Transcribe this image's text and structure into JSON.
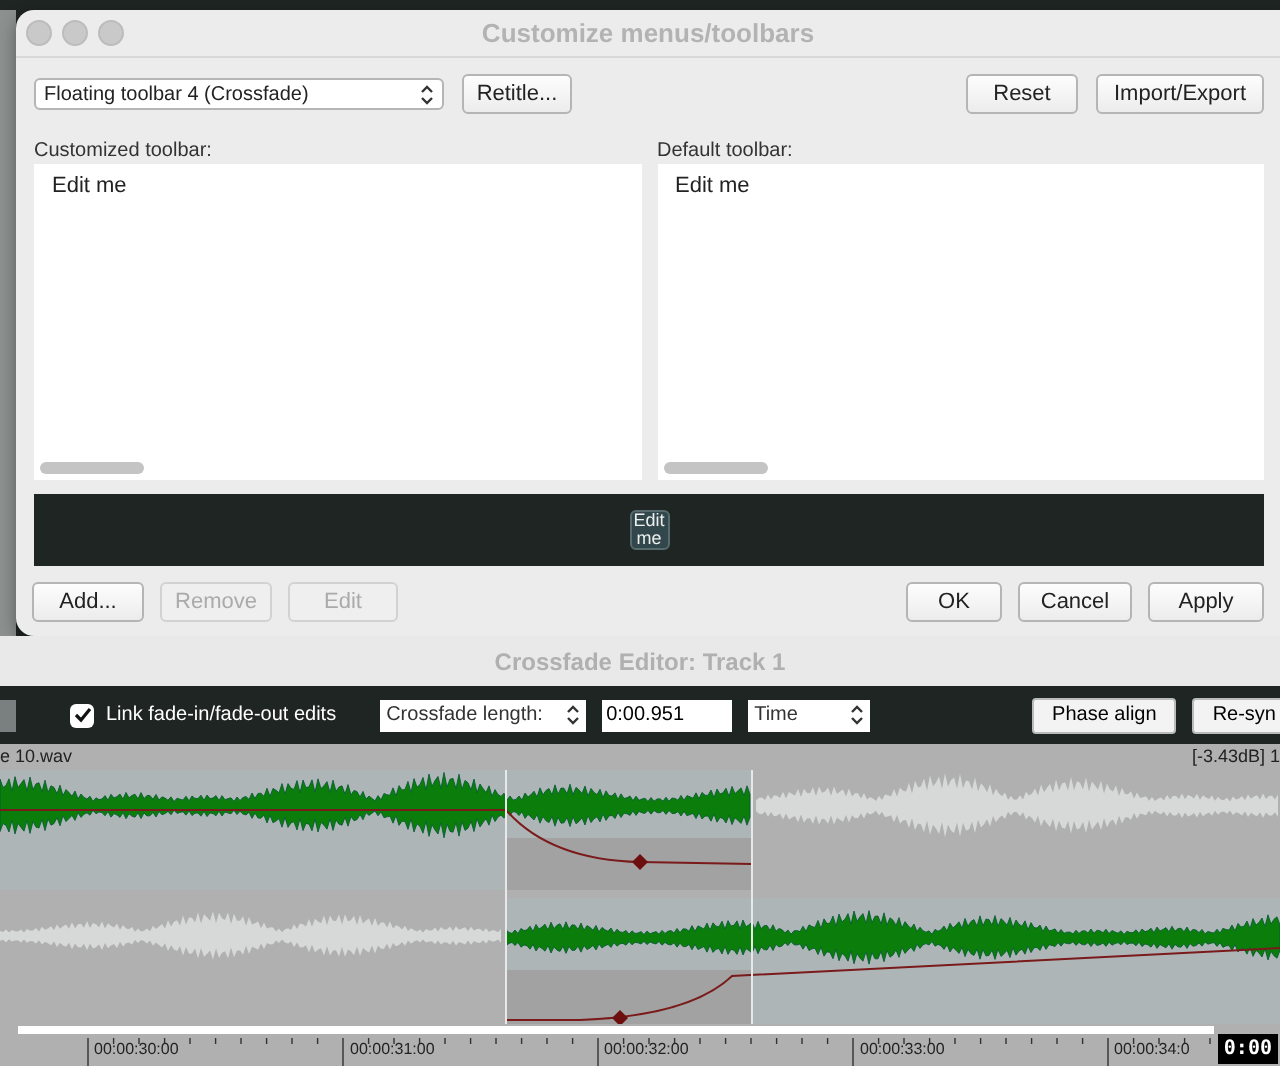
{
  "dialog": {
    "title": "Customize menus/toolbars",
    "toolbar_select": "Floating toolbar 4 (Crossfade)",
    "top_left_buttons": [
      {
        "label": "Retitle..."
      }
    ],
    "top_right_buttons": [
      {
        "label": "Reset"
      },
      {
        "label": "Import/Export"
      }
    ],
    "panels": [
      {
        "label": "Customized toolbar:",
        "items": [
          "Edit me"
        ]
      },
      {
        "label": "Default toolbar:",
        "items": [
          "Edit me"
        ]
      }
    ],
    "preview_button": "Edit me",
    "bottom_left_buttons": [
      {
        "label": "Add...",
        "disabled": false
      },
      {
        "label": "Remove",
        "disabled": true
      },
      {
        "label": "Edit",
        "disabled": true
      }
    ],
    "bottom_right_buttons": [
      {
        "label": "OK",
        "disabled": false
      },
      {
        "label": "Cancel",
        "disabled": false
      },
      {
        "label": "Apply",
        "disabled": false
      }
    ]
  },
  "editor": {
    "title": "Crossfade Editor: Track 1",
    "link_checkbox": {
      "label": "Link fade-in/fade-out edits",
      "checked": true
    },
    "length_select": "Crossfade length:",
    "length_value": "0:00.951",
    "unit_select": "Time",
    "buttons": [
      "Phase align",
      "Re-syn"
    ],
    "file_name": "e 10.wav",
    "gain": "[-3.43dB] 1",
    "ruler": [
      "00:00:30:00",
      "00:00:31:00",
      "00:00:32:00",
      "00:00:33:00",
      "00:00:34:0"
    ]
  },
  "timestamp": "0:00"
}
